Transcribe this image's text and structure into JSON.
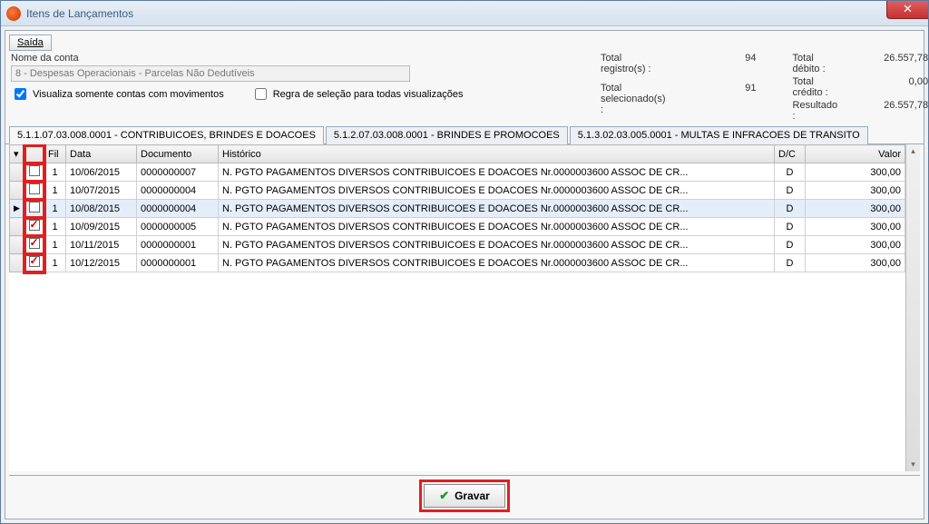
{
  "window": {
    "title": "Itens de Lançamentos",
    "close_glyph": "✕"
  },
  "toolbar": {
    "saida_label": "Saída"
  },
  "account": {
    "label": "Nome da conta",
    "value": "8 - Despesas Operacionais - Parcelas Não Dedutíveis",
    "chk_movimentos_label": "Visualiza somente contas com movimentos",
    "chk_movimentos_checked": true,
    "chk_regra_label": "Regra de seleção para todas visualizações",
    "chk_regra_checked": false
  },
  "totals": {
    "registros_label": "Total registro(s) :",
    "registros_value": "94",
    "selecionados_label": "Total selecionado(s) :",
    "selecionados_value": "91",
    "debito_label": "Total débito :",
    "debito_value": "26.557,78",
    "credito_label": "Total crédito :",
    "credito_value": "0,00",
    "resultado_label": "Resultado :",
    "resultado_value": "26.557,78"
  },
  "tabs": [
    {
      "label": "5.1.1.07.03.008.0001 - CONTRIBUICOES, BRINDES E DOACOES",
      "active": true
    },
    {
      "label": "5.1.2.07.03.008.0001 - BRINDES E PROMOCOES",
      "active": false
    },
    {
      "label": "5.1.3.02.03.005.0001 - MULTAS E INFRACOES DE TRANSITO",
      "active": false
    }
  ],
  "columns": {
    "sel": "",
    "fil": "Fil",
    "data": "Data",
    "documento": "Documento",
    "historico": "Histórico",
    "dc": "D/C",
    "valor": "Valor"
  },
  "rows": [
    {
      "checked": false,
      "indicator": "",
      "fil": "1",
      "data": "10/06/2015",
      "doc": "0000000007",
      "hist": "N. PGTO PAGAMENTOS DIVERSOS CONTRIBUICOES E DOACOES Nr.0000003600 ASSOC DE CR...",
      "dc": "D",
      "valor": "300,00"
    },
    {
      "checked": false,
      "indicator": "",
      "fil": "1",
      "data": "10/07/2015",
      "doc": "0000000004",
      "hist": "N. PGTO PAGAMENTOS DIVERSOS CONTRIBUICOES E DOACOES Nr.0000003600 ASSOC DE CR...",
      "dc": "D",
      "valor": "300,00"
    },
    {
      "checked": false,
      "indicator": "▶",
      "fil": "1",
      "data": "10/08/2015",
      "doc": "0000000004",
      "hist": "N. PGTO PAGAMENTOS DIVERSOS CONTRIBUICOES E DOACOES Nr.0000003600 ASSOC DE CR...",
      "dc": "D",
      "valor": "300,00",
      "selected": true
    },
    {
      "checked": true,
      "indicator": "",
      "fil": "1",
      "data": "10/09/2015",
      "doc": "0000000005",
      "hist": "N. PGTO PAGAMENTOS DIVERSOS CONTRIBUICOES E DOACOES Nr.0000003600 ASSOC DE CR...",
      "dc": "D",
      "valor": "300,00"
    },
    {
      "checked": true,
      "indicator": "",
      "fil": "1",
      "data": "10/11/2015",
      "doc": "0000000001",
      "hist": "N. PGTO PAGAMENTOS DIVERSOS CONTRIBUICOES E DOACOES Nr.0000003600 ASSOC DE CR...",
      "dc": "D",
      "valor": "300,00"
    },
    {
      "checked": true,
      "indicator": "",
      "fil": "1",
      "data": "10/12/2015",
      "doc": "0000000001",
      "hist": "N. PGTO PAGAMENTOS DIVERSOS CONTRIBUICOES E DOACOES Nr.0000003600 ASSOC DE CR...",
      "dc": "D",
      "valor": "300,00"
    }
  ],
  "footer": {
    "gravar_label": "Gravar"
  }
}
